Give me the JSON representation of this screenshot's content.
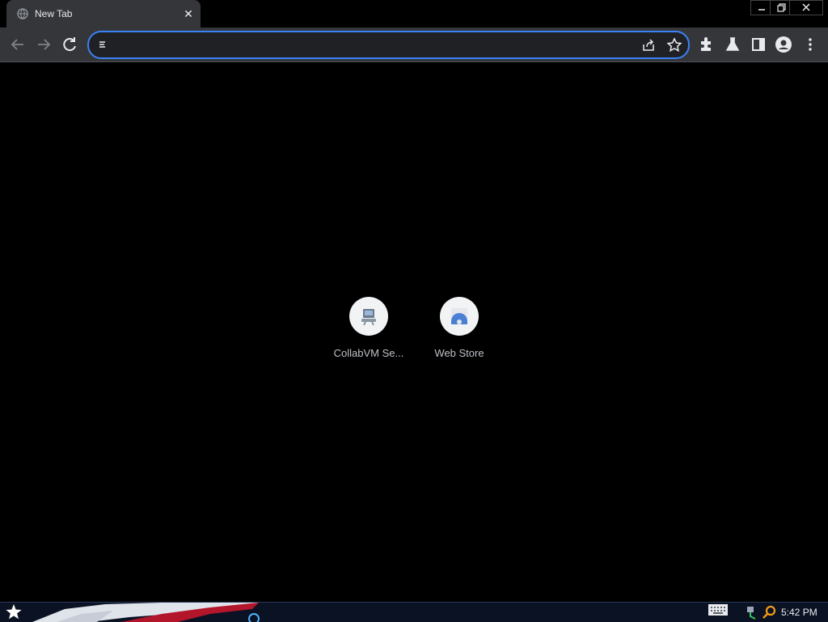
{
  "browser": {
    "tab": {
      "title": "New Tab",
      "close_glyph": "✕"
    },
    "window_controls": [
      "minimize",
      "restore",
      "close"
    ],
    "omnibox": {
      "value": "",
      "placeholder": ""
    },
    "toolbar_icons": [
      "back-icon",
      "forward-icon",
      "reload-icon",
      "share-icon",
      "bookmark-star-icon",
      "extensions-icon",
      "labs-flask-icon",
      "side-panel-icon",
      "profile-icon",
      "menu-icon"
    ]
  },
  "ntp": {
    "shortcuts": [
      {
        "label": "CollabVM Se...",
        "icon": "collabvm-favicon"
      },
      {
        "label": "Web Store",
        "icon": "webstore-icon"
      }
    ]
  },
  "taskbar": {
    "time": "5:42 PM",
    "start_icon": "star-icon",
    "tray_icons": [
      "keyboard-icon",
      "network-icon",
      "search-icon"
    ]
  },
  "colors": {
    "accent": "#3b82f6",
    "toolbar": "#35363a",
    "background": "#000000"
  }
}
